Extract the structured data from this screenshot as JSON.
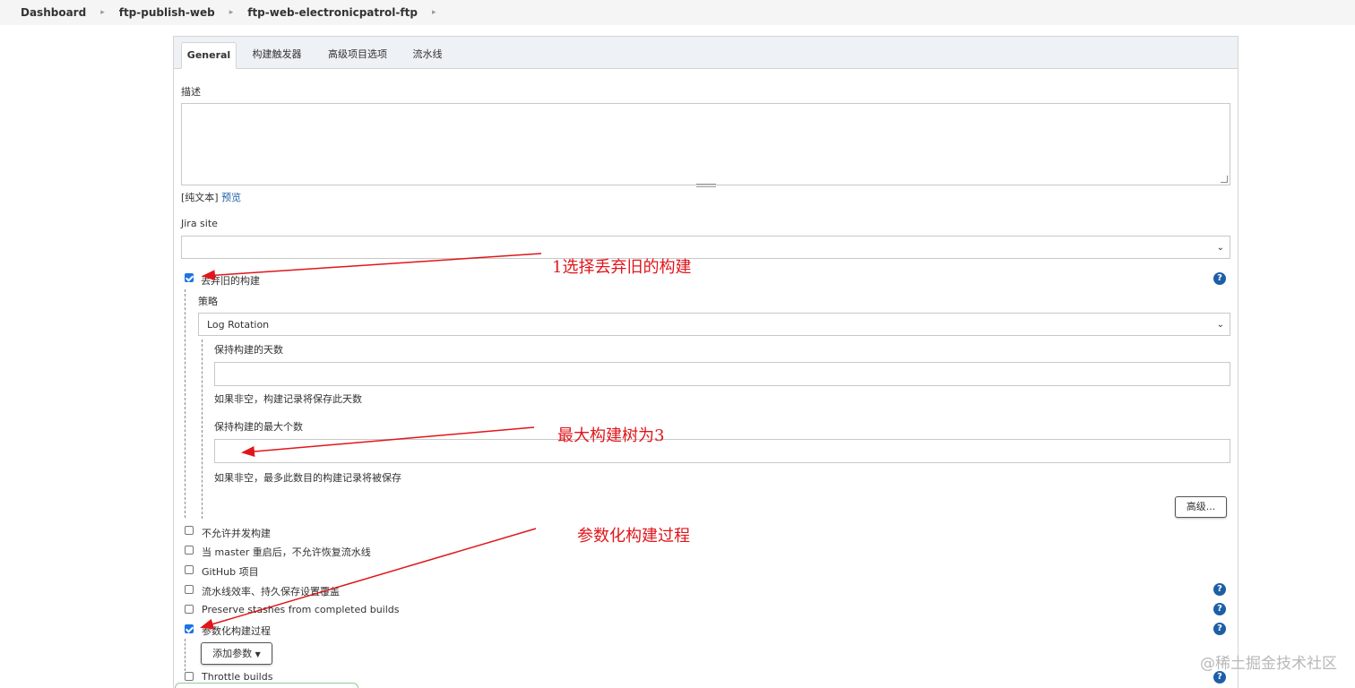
{
  "breadcrumb": [
    "Dashboard",
    "ftp-publish-web",
    "ftp-web-electronicpatrol-ftp"
  ],
  "tabs": [
    "General",
    "构建触发器",
    "高级项目选项",
    "流水线"
  ],
  "description": {
    "label": "描述",
    "plain_text": "[纯文本]",
    "preview": "预览"
  },
  "jira": {
    "label": "Jira site",
    "value": ""
  },
  "discard_old_builds": {
    "label": "丢弃旧的构建",
    "checked": true,
    "strategy_label": "策略",
    "strategy_value": "Log Rotation",
    "days_label": "保持构建的天数",
    "days_value": "",
    "days_hint": "如果非空，构建记录将保存此天数",
    "max_label": "保持构建的最大个数",
    "max_value": "",
    "max_hint": "如果非空，最多此数目的构建记录将被保存",
    "advanced_button": "高级..."
  },
  "options": [
    {
      "label": "不允许并发构建",
      "checked": false
    },
    {
      "label": "当 master 重启后，不允许恢复流水线",
      "checked": false
    },
    {
      "label": "GitHub 项目",
      "checked": false
    },
    {
      "label": "流水线效率、持久保存设置覆盖",
      "checked": false
    },
    {
      "label": "Preserve stashes from completed builds",
      "checked": false
    },
    {
      "label": "参数化构建过程",
      "checked": true
    },
    {
      "label": "Throttle builds",
      "checked": false
    }
  ],
  "add_param_button": "添加参数",
  "help_glyph": "?",
  "annotations": [
    "1选择丢弃旧的构建",
    "最大构建树为3",
    "参数化构建过程"
  ],
  "watermark": "@稀土掘金技术社区",
  "colors": {
    "annotation": "#e0161b",
    "help": "#1d5fa6",
    "checkbox": "#1a73e8",
    "link": "#1f5fa8"
  }
}
